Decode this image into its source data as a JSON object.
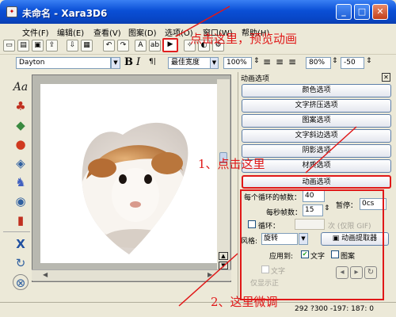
{
  "window": {
    "title": "未命名 - Xara3D6",
    "min_glyph": "_",
    "max_glyph": "□",
    "close_glyph": "✕"
  },
  "menu": [
    "文件(F)",
    "编辑(E)",
    "查看(V)",
    "图案(D)",
    "选项(O)",
    "窗口(W)",
    "帮助(H)"
  ],
  "toolbar2": {
    "font_name": "Dayton",
    "width_mode": "最佳宽度",
    "zoom": "100%",
    "spacing": "80%",
    "offset": "-50"
  },
  "panel": {
    "title": "动画选项",
    "buttons": [
      "颜色选项",
      "文字挤压选项",
      "图案选项",
      "文字斜边选项",
      "阴影选项",
      "材质选项",
      "动画选项"
    ],
    "loop_frames_label": "每个循环的帧数：",
    "loop_frames_value": "40",
    "pause_label": "暂停：",
    "pause_value": "0cs",
    "fps_label": "每秒帧数：",
    "fps_value": "15",
    "loop_label": "循环：",
    "loop_suffix": "次 (仅限 GIF)",
    "style_label": "风格:",
    "style_value": "旋转",
    "extract_button": "动画提取器",
    "apply_label": "应用到:",
    "apply_text": "文字",
    "apply_pattern": "图案",
    "faded_text1": "文字",
    "faded_text2": "仅显示正"
  },
  "status": {
    "coords": "292 ?300 -197: 187: 0"
  },
  "annotations": {
    "top": "点击这里，预览动画",
    "middle": "1、点击这里",
    "bottom": "2、这里微调"
  }
}
